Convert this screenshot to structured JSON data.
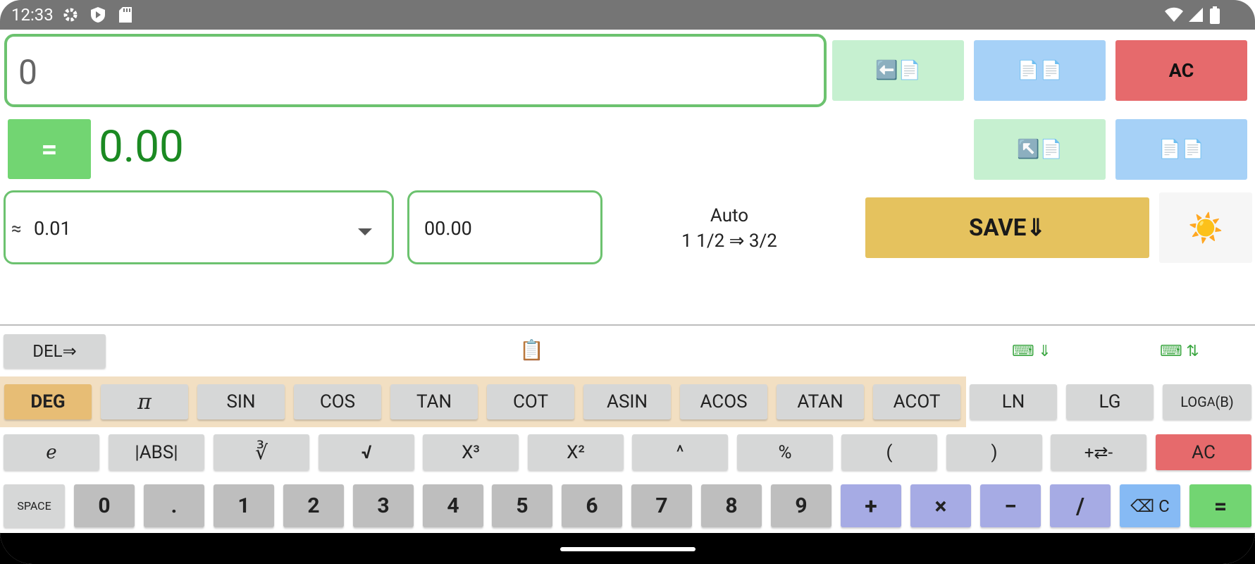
{
  "status": {
    "time": "12:33",
    "icons_left": [
      "gear-icon",
      "shield-icon",
      "sd-card-icon"
    ],
    "icons_right": [
      "wifi-icon",
      "signal-icon",
      "battery-icon"
    ]
  },
  "display": {
    "input_value": "0",
    "result_value": "0.00",
    "equals_label": "="
  },
  "toolbar": {
    "paste_back_label": "⬅️📄",
    "copy_label": "📄📄",
    "ac_label": "AC",
    "paste_cursor_label": "↖️📄",
    "copy2_label": "📄📄"
  },
  "settings": {
    "approx_symbol": "≈",
    "precision_value": "0.01",
    "format_value": "00.00",
    "mode_title": "Auto",
    "mode_example": "1 1/2 ⇒ 3/2",
    "save_label": "SAVE⇓",
    "theme_icon": "☀️"
  },
  "keyboard_bar": {
    "del_label": "DEL⇒",
    "clipboard_icon": "📋",
    "kbd_hide_label": "⌨ ⇓",
    "kbd_swap_label": "⌨ ⇅"
  },
  "keys_row1": [
    "DEG",
    "π",
    "SIN",
    "COS",
    "TAN",
    "COT",
    "ASIN",
    "ACOS",
    "ATAN",
    "ACOT",
    "LN",
    "LG",
    "LOG"
  ],
  "log_sub": "A",
  "log_suffix": "(B)",
  "keys_row2": [
    "e",
    "|ABS|",
    "∛",
    "√",
    "X³",
    "X²",
    "^",
    "%",
    "(",
    ")",
    "+⇄-",
    "AC"
  ],
  "keys_row3": [
    "SPACE",
    "0",
    ".",
    "1",
    "2",
    "3",
    "4",
    "5",
    "6",
    "7",
    "8",
    "9",
    "+",
    "×",
    "−",
    "/",
    "⌫ C",
    "="
  ],
  "colors": {
    "accent_green": "#6cc26f",
    "result_green": "#1b8a22",
    "ac_red": "#e66a6c",
    "save_yellow": "#e5c25e",
    "op_purple": "#a6abe4"
  }
}
